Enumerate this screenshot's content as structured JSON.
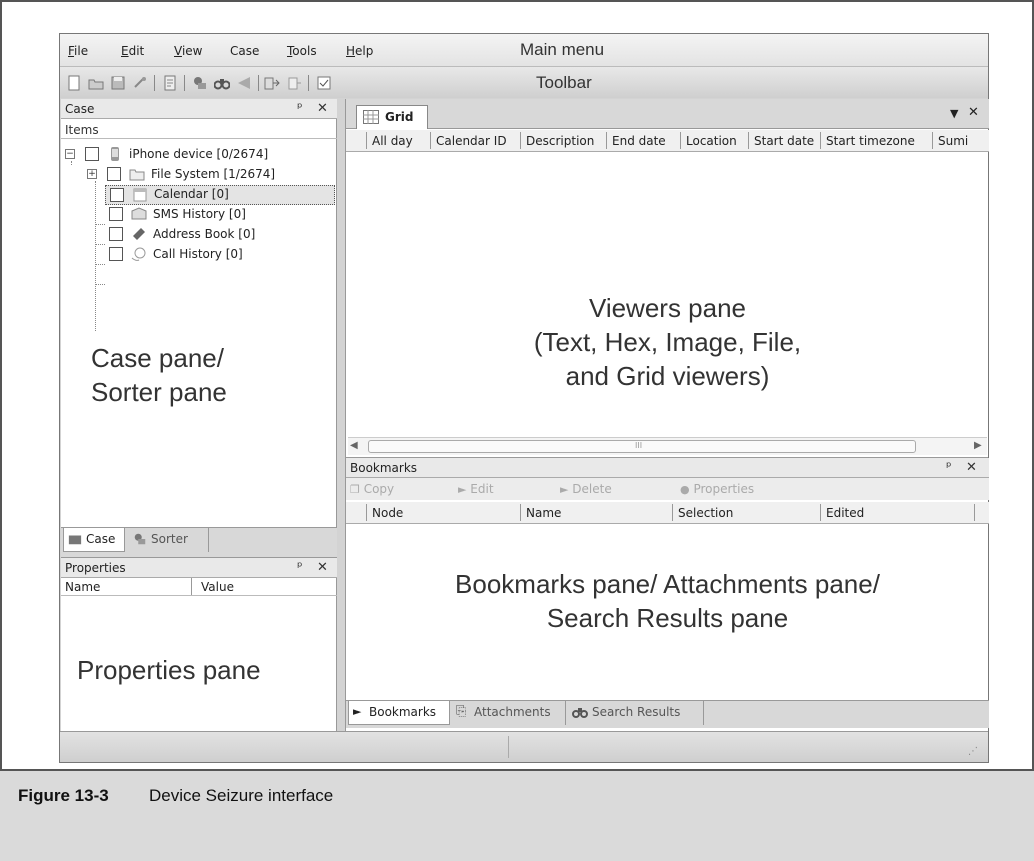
{
  "menu": {
    "items": [
      {
        "label": "File",
        "u": "F",
        "rest": "ile"
      },
      {
        "label": "Edit",
        "u": "E",
        "rest": "dit"
      },
      {
        "label": "View",
        "u": "V",
        "rest": "iew"
      },
      {
        "label": "Case",
        "u": "",
        "rest": "Case"
      },
      {
        "label": "Tools",
        "u": "T",
        "rest": "ools"
      },
      {
        "label": "Help",
        "u": "H",
        "rest": "elp"
      }
    ],
    "annotation": "Main menu"
  },
  "toolbar": {
    "annotation": "Toolbar",
    "icons": [
      "new-icon",
      "open-icon",
      "save-icon",
      "refresh-icon",
      "report-icon",
      "acquire-icon",
      "search-icon",
      "bookmark-icon",
      "export-icon",
      "import-icon",
      "checklist-icon"
    ]
  },
  "case_pane": {
    "title": "Case",
    "items_header": "Items",
    "tree": [
      {
        "label": "iPhone device [0/2674]",
        "icon": "phone-icon"
      },
      {
        "label": "File System [1/2674]",
        "icon": "folder-icon"
      },
      {
        "label": "Calendar [0]",
        "icon": "calendar-icon"
      },
      {
        "label": "SMS History [0]",
        "icon": "sms-icon"
      },
      {
        "label": "Address Book [0]",
        "icon": "address-book-icon"
      },
      {
        "label": "Call History [0]",
        "icon": "call-history-icon"
      }
    ],
    "annotation_line1": "Case pane/",
    "annotation_line2": "Sorter pane",
    "tabs": [
      "Case",
      "Sorter"
    ]
  },
  "properties_pane": {
    "title": "Properties",
    "columns": [
      "Name",
      "Value"
    ],
    "annotation": "Properties pane"
  },
  "viewer": {
    "tab_label": "Grid",
    "columns": [
      "All day",
      "Calendar ID",
      "Description",
      "End date",
      "Location",
      "Start date",
      "Start timezone",
      "Sumi"
    ],
    "annotation_line1": "Viewers pane",
    "annotation_line2": "(Text, Hex, Image, File,",
    "annotation_line3": "and Grid viewers)",
    "scroll_mark": "III"
  },
  "bookmarks_pane": {
    "title": "Bookmarks",
    "toolbar": [
      "Copy",
      "Edit",
      "Delete",
      "Properties"
    ],
    "columns": [
      "Node",
      "Name",
      "Selection",
      "Edited"
    ],
    "annotation_line1": "Bookmarks pane/ Attachments pane/",
    "annotation_line2": "Search Results pane",
    "tabs": [
      "Bookmarks",
      "Attachments",
      "Search Results"
    ]
  },
  "figure": {
    "label": "Figure 13-3",
    "caption": "Device Seizure interface"
  }
}
